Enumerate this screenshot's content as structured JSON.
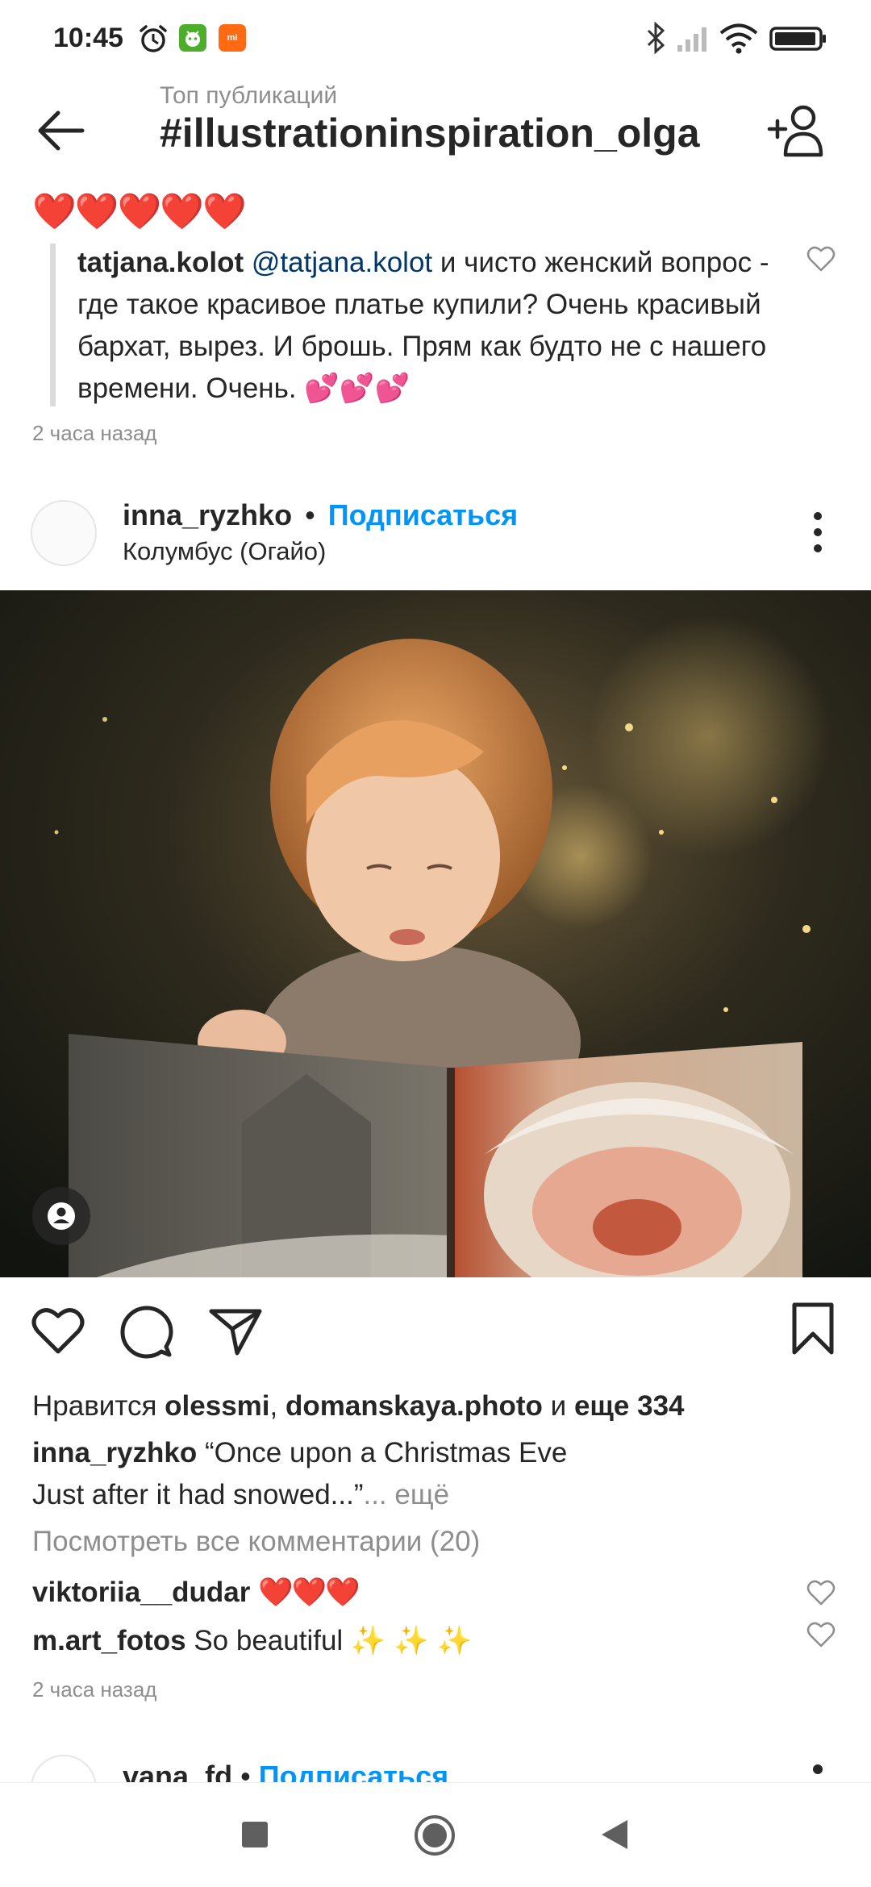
{
  "status_bar": {
    "time": "10:45",
    "icons": [
      "alarm-icon",
      "android-app-icon",
      "mi-app-icon",
      "bluetooth-icon",
      "signal-icon",
      "wifi-icon",
      "battery-icon"
    ],
    "mi_label": "mi"
  },
  "header": {
    "subtitle": "Топ публикаций",
    "title": "#illustrationinspiration_olga",
    "back_icon": "arrow-left-icon",
    "add_user_icon": "person-add-icon"
  },
  "top_comment": {
    "hearts": "❤️❤️❤️❤️❤️",
    "username": "tatjana.kolot",
    "mention": "@tatjana.kolot",
    "text": " и чисто женский вопрос - где такое красивое платье купили? Очень красивый бархат, вырез. И брошь. Прям как будто не с нашего времени. Очень. ",
    "emoji": "💕💕💕",
    "time_ago": "2 часа назад"
  },
  "post": {
    "username": "inna_ryzhko",
    "separator": "•",
    "follow_label": "Подписаться",
    "location": "Колумбус (Огайо)",
    "likes_prefix": "Нравится ",
    "likes_user1": "olessmi",
    "likes_comma": ", ",
    "likes_user2": "domanskaya.photo",
    "likes_and": " и ",
    "likes_more": "еще 334",
    "caption_user": "inna_ryzhko",
    "caption_line1": " “Once upon a Christmas Eve",
    "caption_line2": "Just after it had snowed...”",
    "caption_more": "... ещё",
    "view_comments": "Посмотреть все комментарии (20)",
    "comments": [
      {
        "username": "viktoriia__dudar",
        "text": " ",
        "emoji": "❤️❤️❤️"
      },
      {
        "username": "m.art_fotos",
        "text": " So beautiful ",
        "emoji": "✨ ✨ ✨"
      }
    ],
    "time_ago": "2 часа назад"
  },
  "next_post": {
    "username": "vana_fd",
    "separator": "•",
    "follow_label": "Подписаться"
  },
  "nav_bar": {
    "icons": [
      "recents-square-icon",
      "home-circle-icon",
      "back-triangle-icon"
    ]
  },
  "colors": {
    "accent": "#0095f6",
    "text": "#262626",
    "secondary": "#8e8e8e",
    "heart": "#e0182d"
  }
}
